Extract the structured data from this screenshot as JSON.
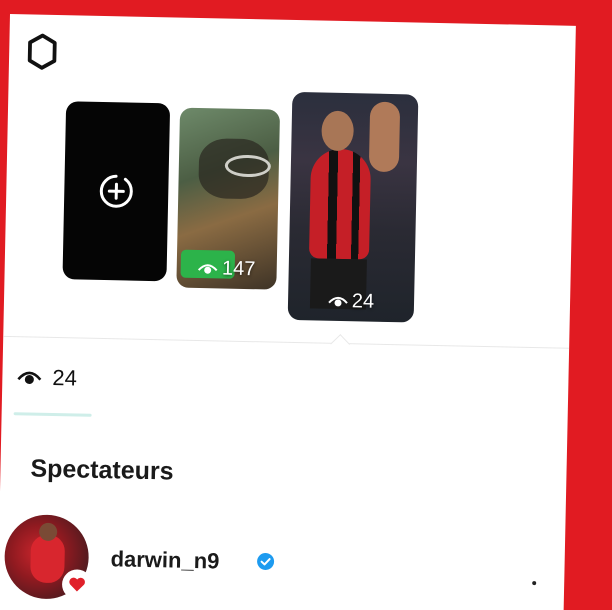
{
  "story_strip": {
    "create_story": {
      "icon": "add-story-icon"
    },
    "stories": [
      {
        "view_count": "147",
        "icon": "eye-icon"
      },
      {
        "view_count": "24",
        "icon": "eye-icon"
      }
    ]
  },
  "viewers_summary": {
    "icon": "eye-icon",
    "count": "24"
  },
  "section": {
    "title": "Spectateurs"
  },
  "viewers": [
    {
      "username": "darwin_n9",
      "verified": true,
      "reaction": "heart"
    }
  ],
  "colors": {
    "frame": "#e11b22",
    "verified": "#1d9bf0",
    "heart": "#e0202a",
    "tab_underline": "#cfeee9"
  }
}
